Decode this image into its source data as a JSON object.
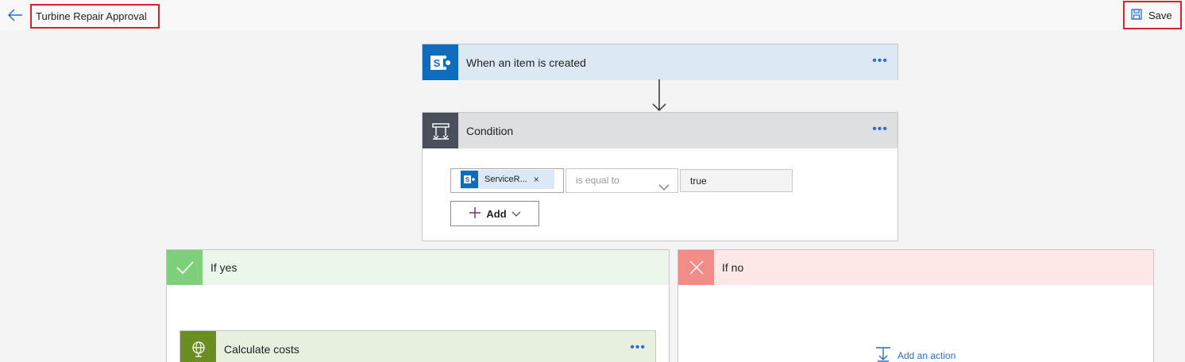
{
  "header": {
    "title": "Turbine Repair Approval",
    "save_label": "Save",
    "back_icon": "arrow-left-icon",
    "save_icon": "floppy-disk-icon"
  },
  "trigger": {
    "title": "When an item is created",
    "icon": "sharepoint-icon",
    "menu": "..."
  },
  "condition": {
    "title": "Condition",
    "icon": "condition-icon",
    "menu": "...",
    "token_label": "ServiceR...",
    "token_remove": "×",
    "operator": "is equal to",
    "value": "true",
    "add_label": "Add"
  },
  "branch_yes": {
    "title": "If yes",
    "icon": "check-icon",
    "action": {
      "title": "Calculate costs",
      "icon": "globe-icon",
      "menu": "..."
    }
  },
  "branch_no": {
    "title": "If no",
    "icon": "close-icon",
    "add_action_label": "Add an action"
  },
  "colors": {
    "sharepoint": "#0f6cbd",
    "trigger_head": "#dde8f5",
    "condition_icon": "#484f59",
    "condition_head": "#dedfe1",
    "yes_icon": "#7ed07b",
    "yes_head": "#eaf7ea",
    "no_icon": "#f28c88",
    "no_head": "#fde8e7",
    "action_icon": "#6b8e23",
    "action_head": "#e7efdf",
    "link": "#2b6cd1",
    "highlight_border": "#d9202e"
  }
}
